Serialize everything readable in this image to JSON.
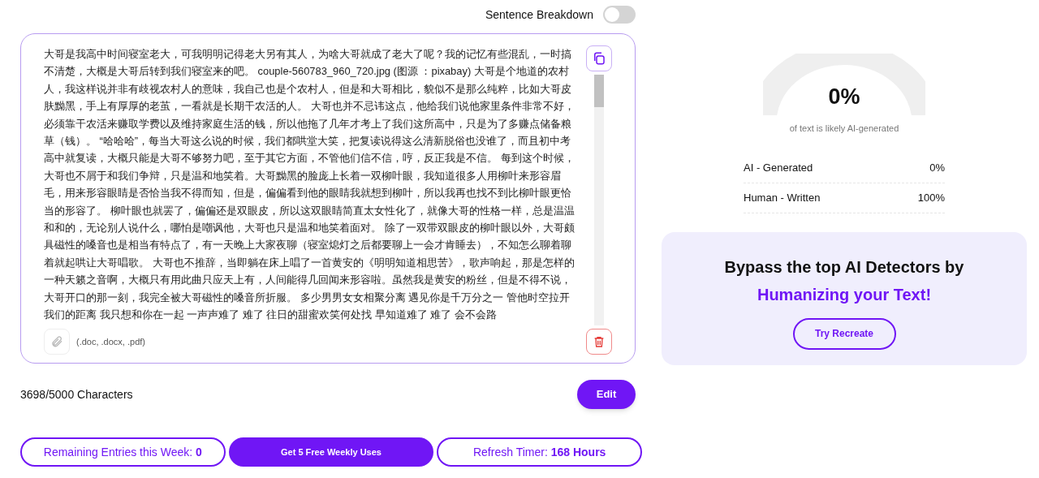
{
  "sentence_breakdown": {
    "label": "Sentence Breakdown",
    "on": false
  },
  "editor": {
    "text": "大哥是我高中时间寝室老大，可我明明记得老大另有其人，为啥大哥就成了老大了呢？我的记忆有些混乱，一时搞不清楚，大概是大哥后转到我们寝室来的吧。 couple-560783_960_720.jpg (图源 ：pixabay) 大哥是个地道的农村人，我这样说并非有歧视农村人的意味，我自己也是个农村人，但是和大哥相比，貌似不是那么纯粹，比如大哥皮肤黝黑，手上有厚厚的老茧，一看就是长期干农活的人。 大哥也并不忌讳这点，他给我们说他家里条件非常不好，必须靠干农活来赚取学费以及维持家庭生活的钱，所以他拖了几年才考上了我们这所高中，只是为了多赚点储备粮草（钱）。 “哈哈哈”，每当大哥这么说的时候，我们都哄堂大笑，把复读说得这么清新脱俗也没谁了，而且初中考高中就复读，大概只能是大哥不够努力吧，至于其它方面，不管他们信不信，哼，反正我是不信。 每到这个时候，大哥也不屑于和我们争辩，只是温和地笑着。大哥黝黑的脸庞上长着一双柳叶眼，我知道很多人用柳叶来形容眉毛，用来形容眼睛是否恰当我不得而知，但是，偏偏看到他的眼睛我就想到柳叶，所以我再也找不到比柳叶眼更恰当的形容了。 柳叶眼也就罢了，偏偏还是双眼皮，所以这双眼睛简直太女性化了，就像大哥的性格一样，总是温温和和的，无论别人说什么，哪怕是嘲讽他，大哥也只是温和地笑着面对。 除了一双带双眼皮的柳叶眼以外，大哥颇具磁性的嗓音也是相当有特点了，有一天晚上大家夜聊（寝室熄灯之后都要聊上一会才肯睡去），不知怎么聊着聊着就起哄让大哥唱歌。 大哥也不推辞，当即躺在床上唱了一首黄安的《明明知道相思苦》，歌声响起，那是怎样的一种天籁之音啊，大概只有用此曲只应天上有，人间能得几回闻来形容啦。虽然我是黄安的粉丝，但是不得不说，大哥开口的那一刻，我完全被大哥磁性的嗓音所折服。 多少男男女女相聚分离 遇见你是千万分之一 管他时空拉开我们的距离 我只想和你在一起 一声声难了 难了 往日的甜蜜欢笑何处找 早知道难了 难了 会不会路",
    "file_hint": "(.doc, .docx, .pdf)"
  },
  "char_count": "3698/5000 Characters",
  "edit_button": "Edit",
  "footer_buttons": [
    {
      "kind": "outline",
      "text": "Remaining Entries this Week: **0**"
    },
    {
      "kind": "filled",
      "text": "Get 5 Free Weekly Uses"
    },
    {
      "kind": "outline",
      "text": "Refresh Timer: **168 Hours**"
    }
  ],
  "gauge": {
    "value": "0%",
    "caption": "of text is likely AI-generated"
  },
  "breakdown": [
    {
      "label": "AI - Generated",
      "value": "0%"
    },
    {
      "label": "Human - Written",
      "value": "100%"
    }
  ],
  "promo": {
    "title": "Bypass the top AI Detectors by",
    "highlight": "Humanizing your Text!",
    "button": "Try Recreate"
  }
}
